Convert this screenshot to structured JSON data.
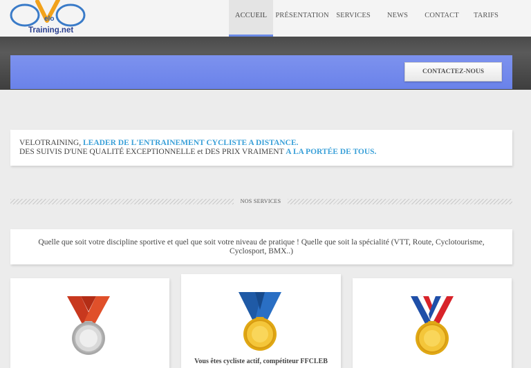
{
  "header": {
    "logo": {
      "brand_small": "elo",
      "brand_text": "Training.net"
    },
    "nav": [
      {
        "label": "ACCUEIL",
        "active": true
      },
      {
        "label": "PRÉSENTATION",
        "active": false
      },
      {
        "label": "SERVICES",
        "active": false
      },
      {
        "label": "NEWS",
        "active": false
      },
      {
        "label": "CONTACT",
        "active": false
      },
      {
        "label": "TARIFS",
        "active": false
      }
    ]
  },
  "banner": {
    "contact_button": "CONTACTEZ-NOUS"
  },
  "intro": {
    "line1_plain": "VELOTRAINING, ",
    "line1_highlight": "LEADER DE L'ENTRAINEMENT CYCLISTE A DISTANCE.",
    "line2_plain": "DES SUIVIS D'UNE QUALITÉ EXCEPTIONNELLE et DES PRIX VRAIMENT ",
    "line2_highlight": "A LA PORTÉE DE TOUS."
  },
  "services": {
    "title": "NOS SERVICES",
    "description": "Quelle que soit votre discipline sportive et quel que soit votre niveau de pratique ! Quelle que soit la spécialité (VTT, Route, Cyclotourisme, Cyclosport, BMX..)",
    "cards": [
      {
        "medal": "silver-medal-icon",
        "text": ""
      },
      {
        "medal": "gold-medal-blue-ribbon-icon",
        "text": "Vous êtes cycliste actif, compétiteur FFCLEB"
      },
      {
        "medal": "gold-medal-tricolor-ribbon-icon",
        "text": ""
      }
    ]
  },
  "colors": {
    "accent_blue": "#6a82ea",
    "highlight_text": "#3aa0d8",
    "dark_band": "#4a4a4a"
  }
}
